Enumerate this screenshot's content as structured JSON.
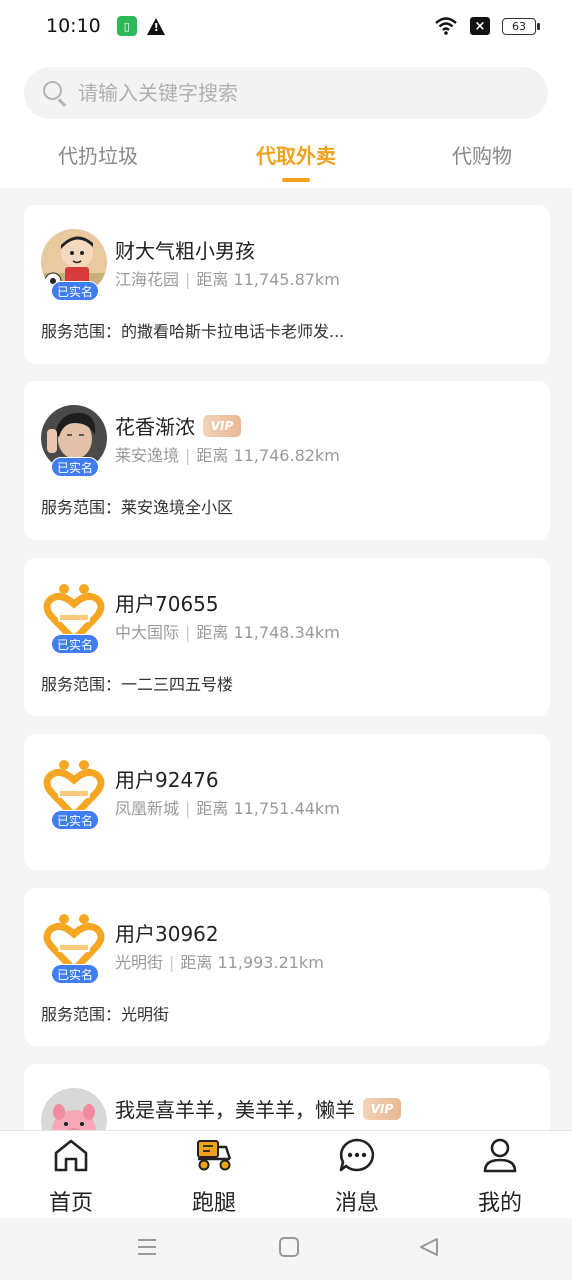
{
  "status_bar": {
    "time": "10:10",
    "battery": "63",
    "icons": [
      "sim-icon",
      "warning-icon",
      "wifi-icon",
      "close-box-icon",
      "battery-icon"
    ]
  },
  "search": {
    "placeholder": "请输入关键字搜索",
    "value": ""
  },
  "tabs": [
    {
      "label": "代扔垃圾",
      "active": false
    },
    {
      "label": "代取外卖",
      "active": true
    },
    {
      "label": "代购物",
      "active": false
    }
  ],
  "colors": {
    "accent": "#f0a21b",
    "verified_badge": "#3f7df0",
    "vip_badge": "#e8b894",
    "background": "#f5f5f5"
  },
  "cards": [
    {
      "name": "财大气粗小男孩",
      "vip": false,
      "avatar": "cartoon-boy-avatar",
      "verified": "已实名",
      "location": "江海花园",
      "distance": "距离 11,745.87km",
      "service": "服务范围：的撒看哈斯卡拉电话卡老师发..."
    },
    {
      "name": "花香渐浓",
      "vip": true,
      "vip_label": "VIP",
      "avatar": "young-man-photo-avatar",
      "verified": "已实名",
      "location": "莱安逸境",
      "distance": "距离 11,746.82km",
      "service": "服务范围：莱安逸境全小区"
    },
    {
      "name": "用户70655",
      "vip": false,
      "avatar": "default-heart-logo-avatar",
      "verified": "已实名",
      "location": "中大国际",
      "distance": "距离 11,748.34km",
      "service": "服务范围：一二三四五号楼"
    },
    {
      "name": "用户92476",
      "vip": false,
      "avatar": "default-heart-logo-avatar",
      "verified": "已实名",
      "location": "凤凰新城",
      "distance": "距离 11,751.44km",
      "service": ""
    },
    {
      "name": "用户30962",
      "vip": false,
      "avatar": "default-heart-logo-avatar",
      "verified": "已实名",
      "location": "光明街",
      "distance": "距离 11,993.21km",
      "service": "服务范围：光明街"
    },
    {
      "name": "我是喜羊羊，美羊羊，懒羊",
      "vip": true,
      "vip_label": "VIP",
      "avatar": "pink-pig-avatar"
    }
  ],
  "bottom_nav": [
    {
      "label": "首页",
      "icon": "home-icon"
    },
    {
      "label": "跑腿",
      "icon": "delivery-scooter-icon",
      "active": true
    },
    {
      "label": "消息",
      "icon": "chat-bubble-icon"
    },
    {
      "label": "我的",
      "icon": "user-icon"
    }
  ],
  "system_nav": [
    "menu-icon",
    "home-square-icon",
    "back-triangle-icon"
  ]
}
